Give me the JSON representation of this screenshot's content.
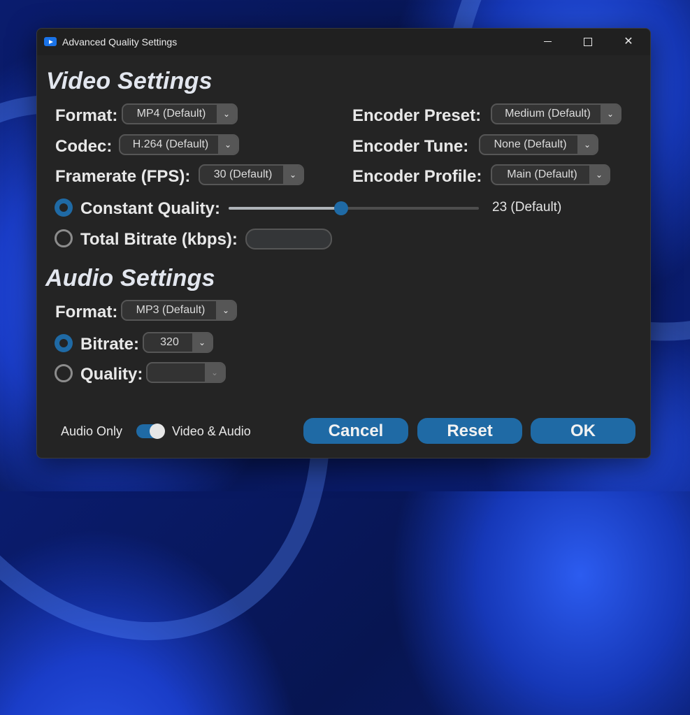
{
  "window": {
    "title": "Advanced Quality Settings"
  },
  "icons": {
    "app": "app-play-icon",
    "minimize": "minimize-icon",
    "maximize": "maximize-icon",
    "close": "close-icon",
    "dropdown": "chevron-down-icon"
  },
  "video": {
    "heading": "Video Settings",
    "format": {
      "label": "Format:",
      "value": "MP4 (Default)"
    },
    "codec": {
      "label": "Codec:",
      "value": "H.264 (Default)"
    },
    "framerate": {
      "label": "Framerate (FPS):",
      "value": "30 (Default)"
    },
    "encoder_preset": {
      "label": "Encoder Preset:",
      "value": "Medium (Default)"
    },
    "encoder_tune": {
      "label": "Encoder Tune:",
      "value": "None (Default)"
    },
    "encoder_profile": {
      "label": "Encoder Profile:",
      "value": "Main (Default)"
    },
    "constant_quality": {
      "label": "Constant Quality:",
      "selected": true,
      "value_text": "23 (Default)",
      "slider_fraction": 0.45
    },
    "total_bitrate": {
      "label": "Total Bitrate (kbps):",
      "selected": false,
      "value": ""
    }
  },
  "audio": {
    "heading": "Audio Settings",
    "format": {
      "label": "Format:",
      "value": "MP3 (Default)"
    },
    "bitrate": {
      "label": "Bitrate:",
      "selected": true,
      "value": "320"
    },
    "quality": {
      "label": "Quality:",
      "selected": false,
      "value": ""
    }
  },
  "footer": {
    "mode_left": "Audio Only",
    "mode_right": "Video & Audio",
    "mode_switch_on": true,
    "cancel": "Cancel",
    "reset": "Reset",
    "ok": "OK"
  },
  "colors": {
    "accent": "#1f6aa5",
    "window_bg": "#242424",
    "titlebar_bg": "#202020",
    "dropdown_bg": "#333333",
    "dropdown_button": "#565656"
  }
}
